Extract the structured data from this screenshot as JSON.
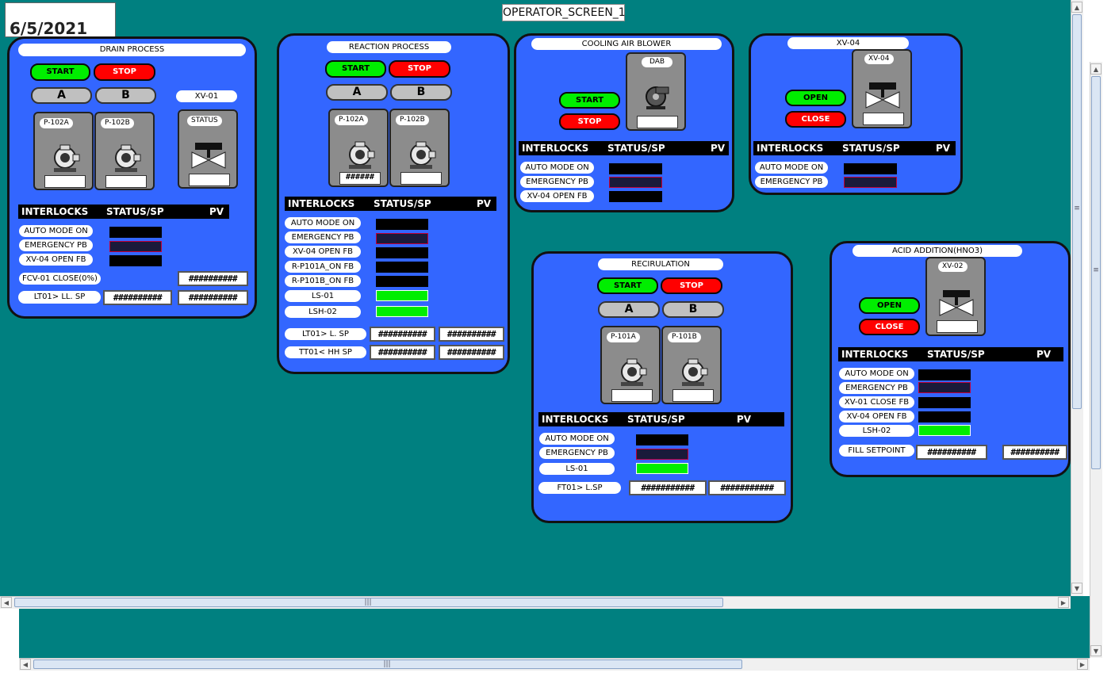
{
  "screen": {
    "date": "6/5/2021",
    "title": "OPERATOR_SCREEN_1"
  },
  "common": {
    "start": "START",
    "stop": "STOP",
    "open": "OPEN",
    "close": "CLOSE",
    "a": "A",
    "b": "B",
    "interlocks": "INTERLOCKS",
    "status_sp": "STATUS/SP",
    "pv": "PV",
    "auto_mode_on": "AUTO MODE ON",
    "emergency_pb": "EMERGENCY PB",
    "hash10": "##########",
    "hash11": "###########",
    "hash6": "######"
  },
  "drain": {
    "title": "DRAIN PROCESS",
    "pump_a": "P-102A",
    "pump_b": "P-102B",
    "valve_tag": "XV-01",
    "valve_status": "STATUS",
    "interlock3": "XV-04 OPEN FB",
    "fcv": "FCV-01  CLOSE(0%)",
    "lt": "LT01> LL. SP"
  },
  "reaction": {
    "title": "REACTION PROCESS",
    "pump_a": "P-102A",
    "pump_b": "P-102B",
    "interlocks": [
      "XV-04 OPEN FB",
      "R-P101A_ON FB",
      "R-P101B_ON FB",
      "LS-01",
      "LSH-02"
    ],
    "lt": "LT01> L. SP",
    "tt": "TT01< HH SP"
  },
  "cooling": {
    "title": "COOLING AIR BLOWER",
    "blower": "DAB",
    "interlock3": "XV-04 OPEN FB"
  },
  "xv04": {
    "title": "XV-04",
    "valve_tag": "XV-04"
  },
  "recirc": {
    "title": "RECIRULATION",
    "pump_a": "P-101A",
    "pump_b": "P-101B",
    "interlock3": "LS-01",
    "ft": "FT01> L.SP"
  },
  "acid": {
    "title": "ACID ADDITION(HNO3)",
    "valve_tag": "XV-02",
    "interlocks": [
      "XV-01 CLOSE FB",
      "XV-04 OPEN FB",
      "LSH-02"
    ],
    "fill": "FILL SETPOINT"
  },
  "colors": {
    "background": "#008080",
    "panel": "#3366ff",
    "running": "#00ee00",
    "stop": "#ff0000"
  }
}
